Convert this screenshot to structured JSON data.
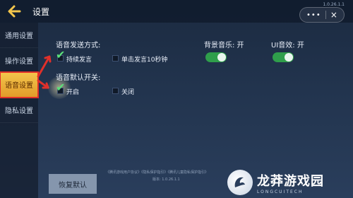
{
  "header": {
    "title": "设置",
    "version": "1.0.26.1.1",
    "menu_dots": "•••",
    "close_symbol": "×"
  },
  "sidebar": {
    "items": [
      {
        "label": "通用设置",
        "active": false
      },
      {
        "label": "操作设置",
        "active": false
      },
      {
        "label": "语音设置",
        "active": true
      },
      {
        "label": "隐私设置",
        "active": false
      }
    ]
  },
  "voice_send": {
    "label": "语音发送方式:",
    "options": [
      {
        "label": "持续发言",
        "checked": true
      },
      {
        "label": "单击发言10秒钟",
        "checked": false
      }
    ]
  },
  "voice_default": {
    "label": "语音默认开关:",
    "options": [
      {
        "label": "开启",
        "checked": true
      },
      {
        "label": "关闭",
        "checked": false
      }
    ]
  },
  "bg_music": {
    "label": "背景音乐: 开",
    "on": true
  },
  "ui_sound": {
    "label": "UI音效: 开",
    "on": true
  },
  "footer": {
    "links": "《腾讯游戏用户协议》《隐私保护指引》《腾讯儿童隐私保护指引》",
    "version": "版本: 1.0.26.1.1"
  },
  "reset_button": {
    "label": "恢复默认"
  },
  "watermark": {
    "main": "龙莽游戏园",
    "sub": "LONGCUITECH"
  },
  "colors": {
    "toggle_on": "#2f9e4b",
    "active_tab": "#f3c64c",
    "highlight": "#e0302a",
    "check": "#5be07a"
  }
}
